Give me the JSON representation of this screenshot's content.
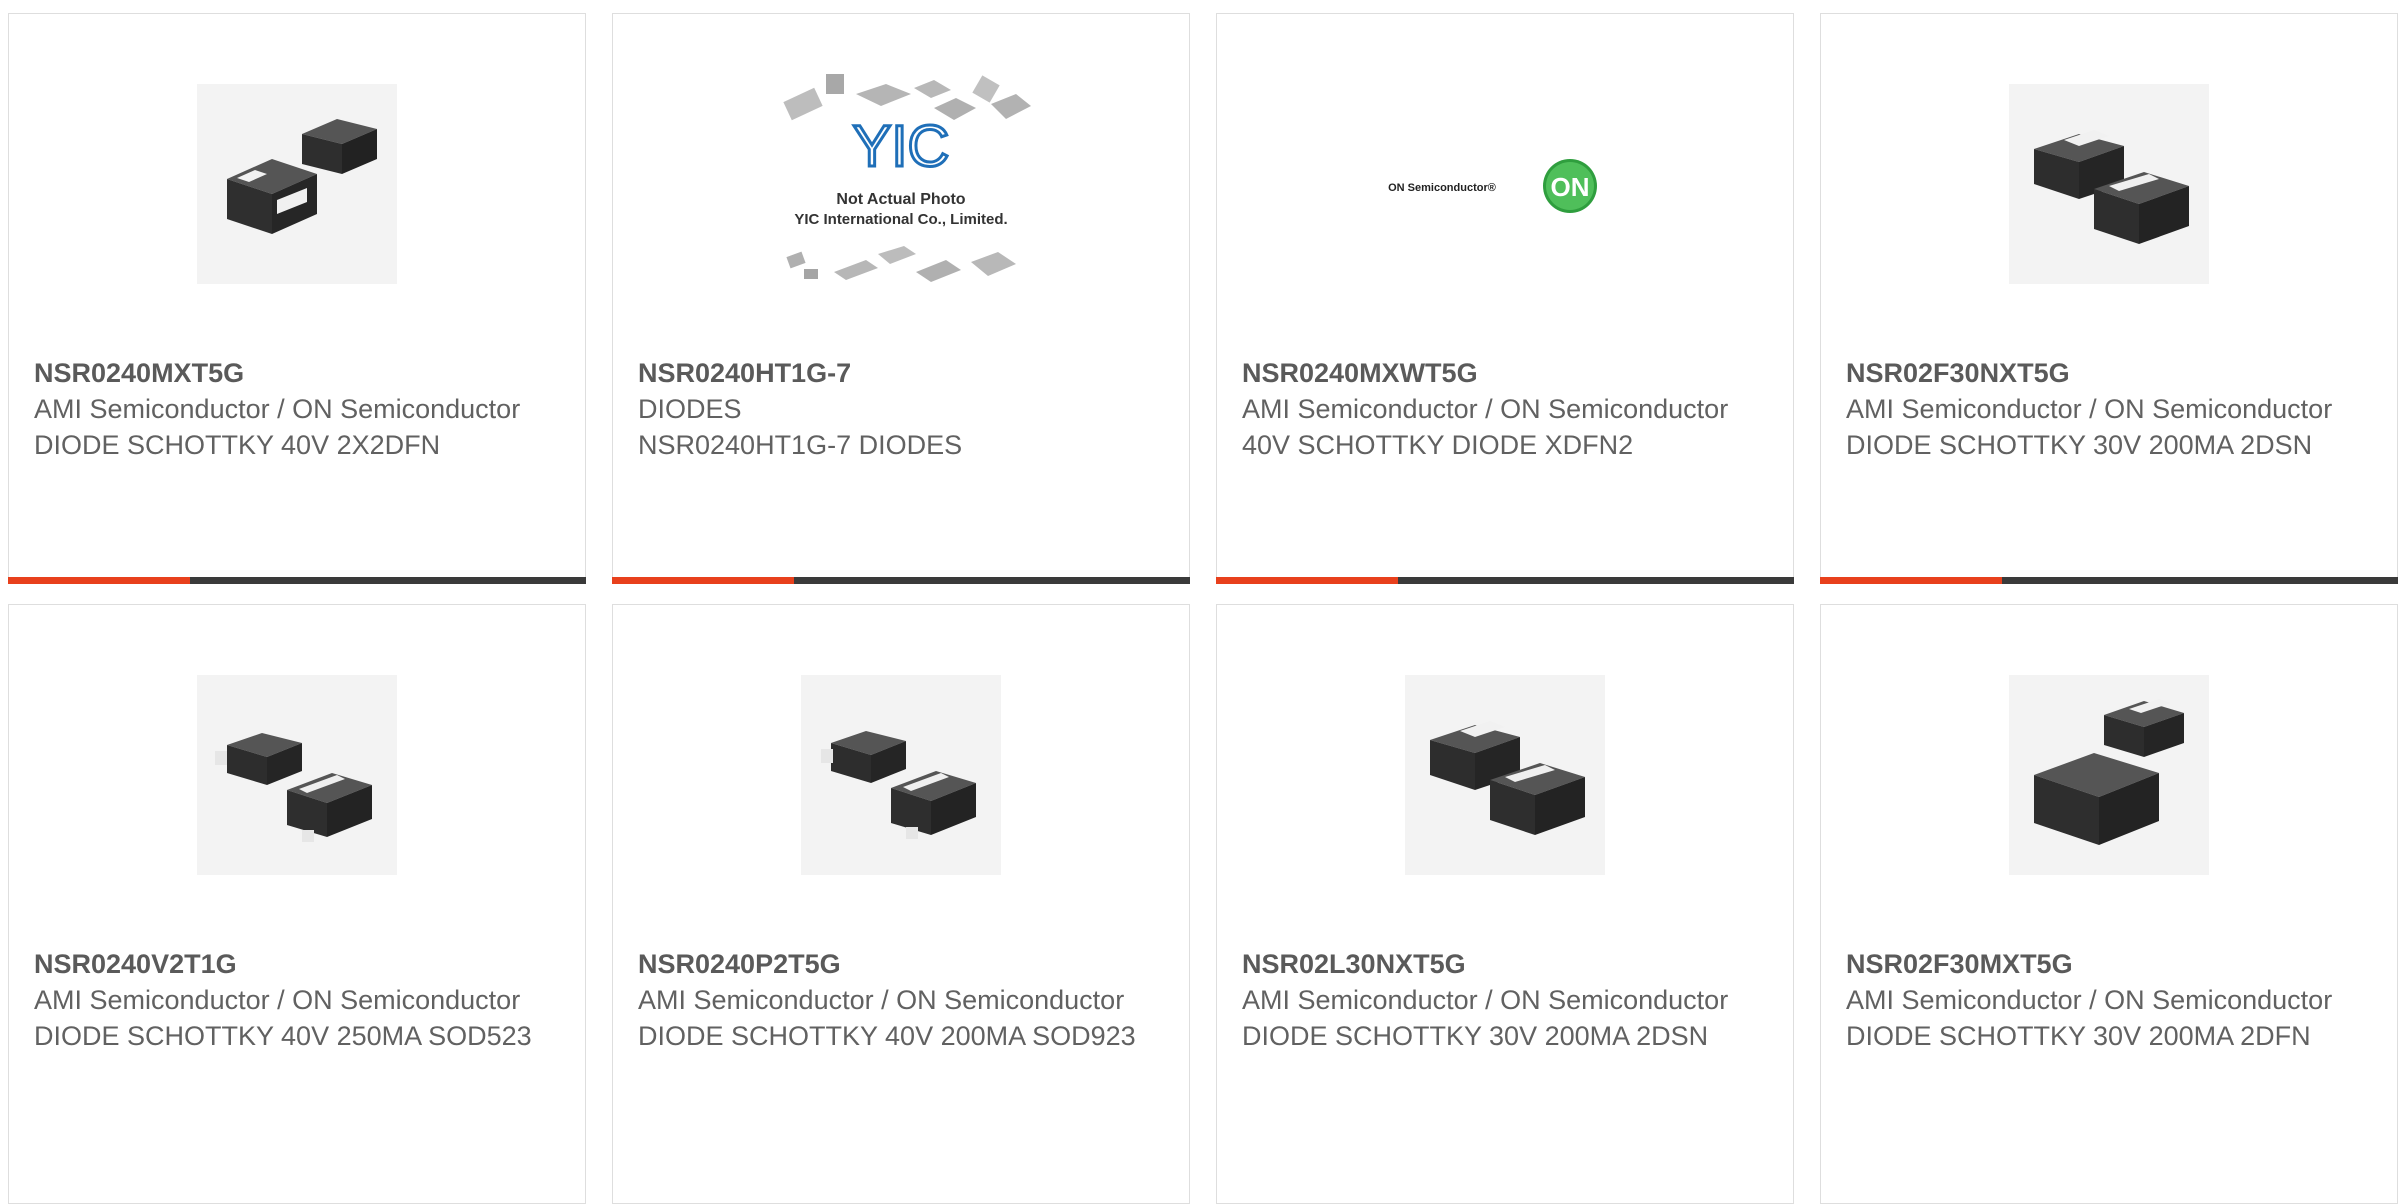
{
  "colors": {
    "accent": "#e8401c",
    "bar": "#3a3a3a",
    "text": "#616161",
    "border": "#dedede"
  },
  "products": [
    {
      "part_number": "NSR0240MXT5G",
      "manufacturer": "AMI Semiconductor / ON Semiconductor",
      "description": "DIODE SCHOTTKY 40V 2X2DFN",
      "image": "diode-package-pair-image"
    },
    {
      "part_number": "NSR0240HT1G-7",
      "manufacturer": "DIODES",
      "description": "NSR0240HT1G-7 DIODES",
      "image": "yic-placeholder-image",
      "image_caption_1": "Not Actual Photo",
      "image_caption_2": "YIC International Co., Limited.",
      "image_logo": "YIC"
    },
    {
      "part_number": "NSR0240MXWT5G",
      "manufacturer": "AMI Semiconductor / ON Semiconductor",
      "description": "40V SCHOTTKY DIODE XDFN2",
      "image": "on-semiconductor-logo-image",
      "image_logo_text": "ON Semiconductor®",
      "image_logo_badge": "ON"
    },
    {
      "part_number": "NSR02F30NXT5G",
      "manufacturer": "AMI Semiconductor / ON Semiconductor",
      "description": "DIODE SCHOTTKY 30V 200MA 2DSN",
      "image": "diode-package-pair-image"
    },
    {
      "part_number": "NSR0240V2T1G",
      "manufacturer": "AMI Semiconductor / ON Semiconductor",
      "description": "DIODE SCHOTTKY 40V 250MA SOD523",
      "image": "diode-sod-pair-image"
    },
    {
      "part_number": "NSR0240P2T5G",
      "manufacturer": "AMI Semiconductor / ON Semiconductor",
      "description": "DIODE SCHOTTKY 40V 200MA SOD923",
      "image": "diode-sod-pair-image"
    },
    {
      "part_number": "NSR02L30NXT5G",
      "manufacturer": "AMI Semiconductor / ON Semiconductor",
      "description": "DIODE SCHOTTKY 30V 200MA 2DSN",
      "image": "diode-package-pair-image"
    },
    {
      "part_number": "NSR02F30MXT5G",
      "manufacturer": "AMI Semiconductor / ON Semiconductor",
      "description": "DIODE SCHOTTKY 30V 200MA 2DFN",
      "image": "diode-package-pair-image"
    }
  ]
}
